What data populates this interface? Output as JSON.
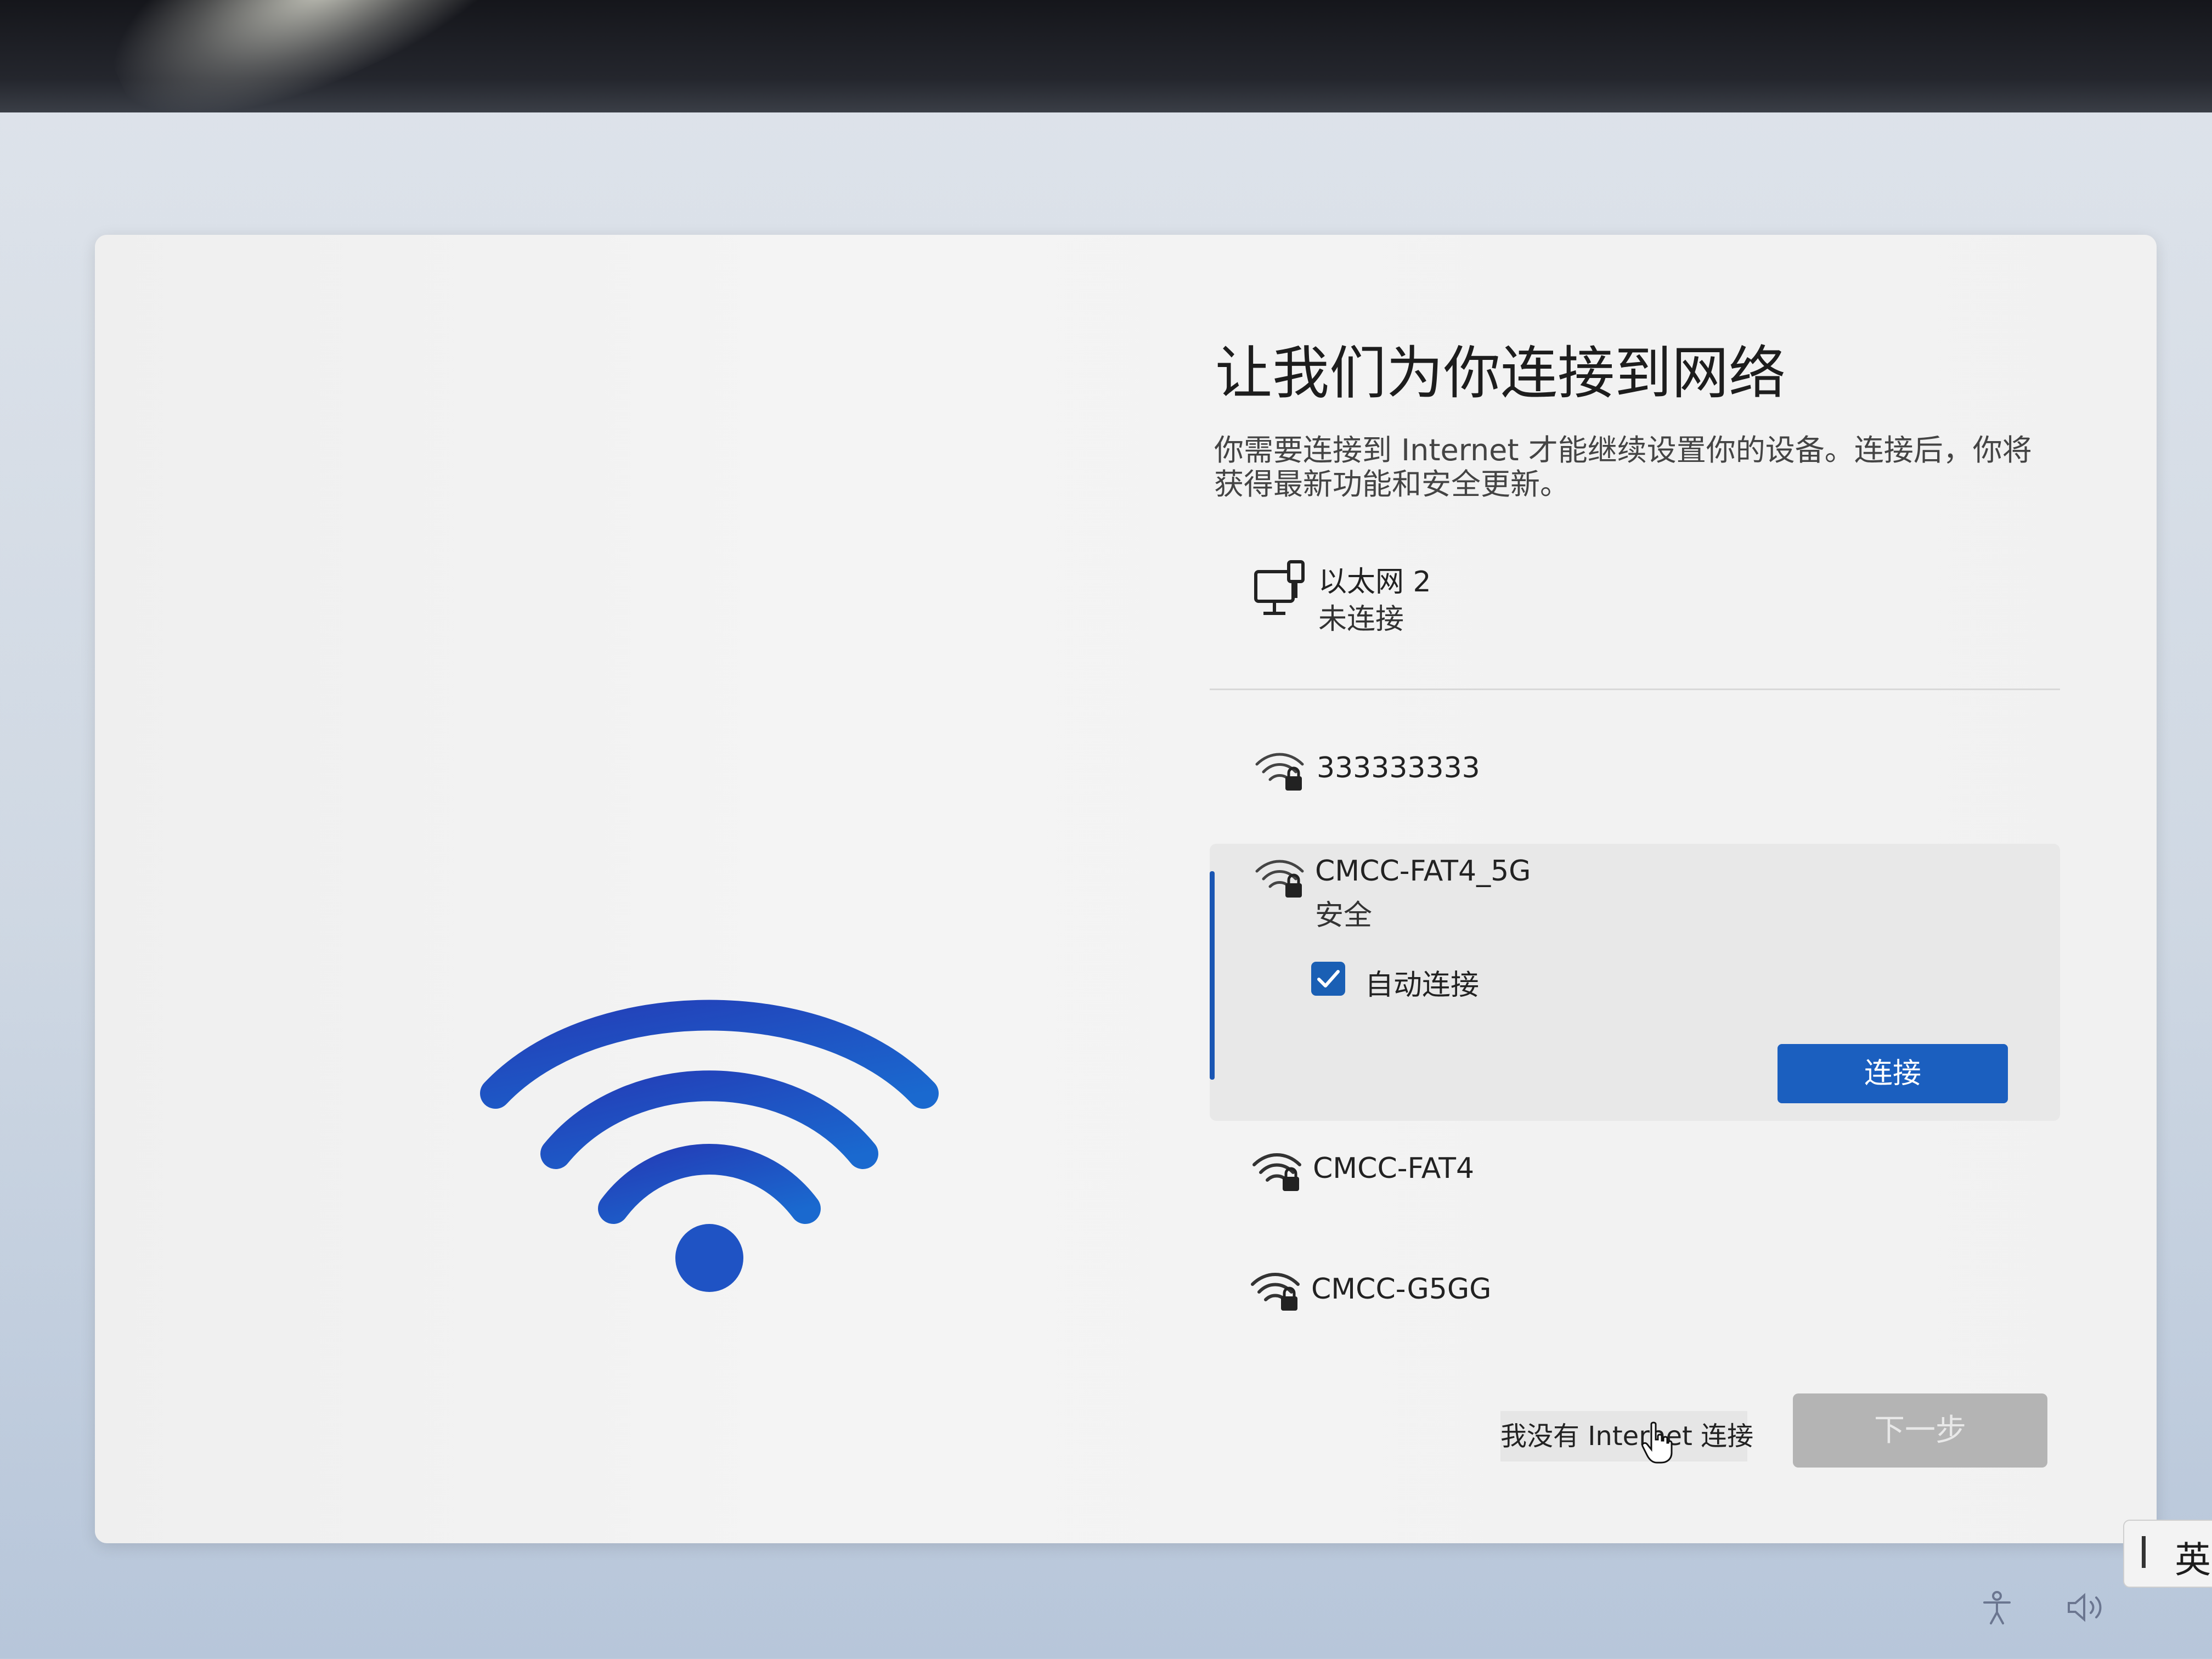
{
  "page": {
    "title": "让我们为你连接到网络",
    "description": "你需要连接到 Internet 才能继续设置你的设备。连接后，你将获得最新功能和安全更新。"
  },
  "networks": {
    "ethernet": {
      "name": "以太网 2",
      "status": "未连接",
      "icon": "ethernet-icon"
    },
    "wifi": [
      {
        "name": "333333333",
        "icon": "wifi-secured-icon"
      },
      {
        "name": "CMCC-FAT4_5G",
        "status": "安全",
        "icon": "wifi-secured-icon",
        "auto_connect_label": "自动连接",
        "auto_connect_checked": true,
        "connect_label": "连接"
      },
      {
        "name": "CMCC-FAT4",
        "icon": "wifi-secured-icon"
      },
      {
        "name": "CMCC-G5GG",
        "icon": "wifi-secured-icon"
      }
    ]
  },
  "footer": {
    "no_internet_label": "我没有 Internet 连接",
    "next_label": "下一步"
  },
  "taskbar": {
    "ime_label": "英"
  },
  "colors": {
    "accent": "#1b5fbf",
    "card_background": "#f2f2f2",
    "disabled_button": "#b4b4b4"
  }
}
